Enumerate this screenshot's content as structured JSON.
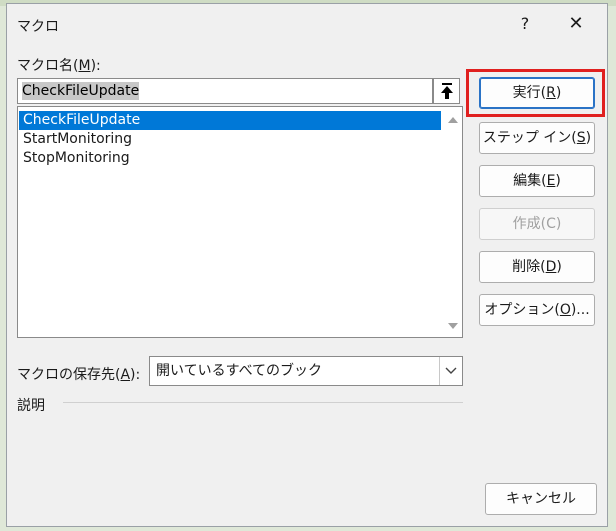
{
  "dialog": {
    "title": "マクロ",
    "help_label": "?",
    "close_label": "✕"
  },
  "macro_name": {
    "label_prefix": "マクロ名(",
    "label_key": "M",
    "label_suffix": "):",
    "value": "CheckFileUpdate"
  },
  "macro_list": {
    "items": [
      {
        "label": "CheckFileUpdate",
        "selected": true
      },
      {
        "label": "StartMonitoring",
        "selected": false
      },
      {
        "label": "StopMonitoring",
        "selected": false
      }
    ]
  },
  "buttons": {
    "run": {
      "prefix": "実行(",
      "key": "R",
      "suffix": ")"
    },
    "step_into": {
      "prefix": "ステップ イン(",
      "key": "S",
      "suffix": ")"
    },
    "edit": {
      "prefix": "編集(",
      "key": "E",
      "suffix": ")"
    },
    "create": {
      "label": "作成(C)"
    },
    "delete": {
      "prefix": "削除(",
      "key": "D",
      "suffix": ")"
    },
    "options": {
      "prefix": "オプション(",
      "key": "O",
      "suffix": ")..."
    },
    "cancel": {
      "label": "キャンセル"
    }
  },
  "save_location": {
    "label_prefix": "マクロの保存先(",
    "label_key": "A",
    "label_suffix": "):",
    "value": "開いているすべてのブック"
  },
  "description": {
    "label": "説明"
  },
  "colors": {
    "highlight": "#e0201f",
    "selection": "#0078d7"
  }
}
